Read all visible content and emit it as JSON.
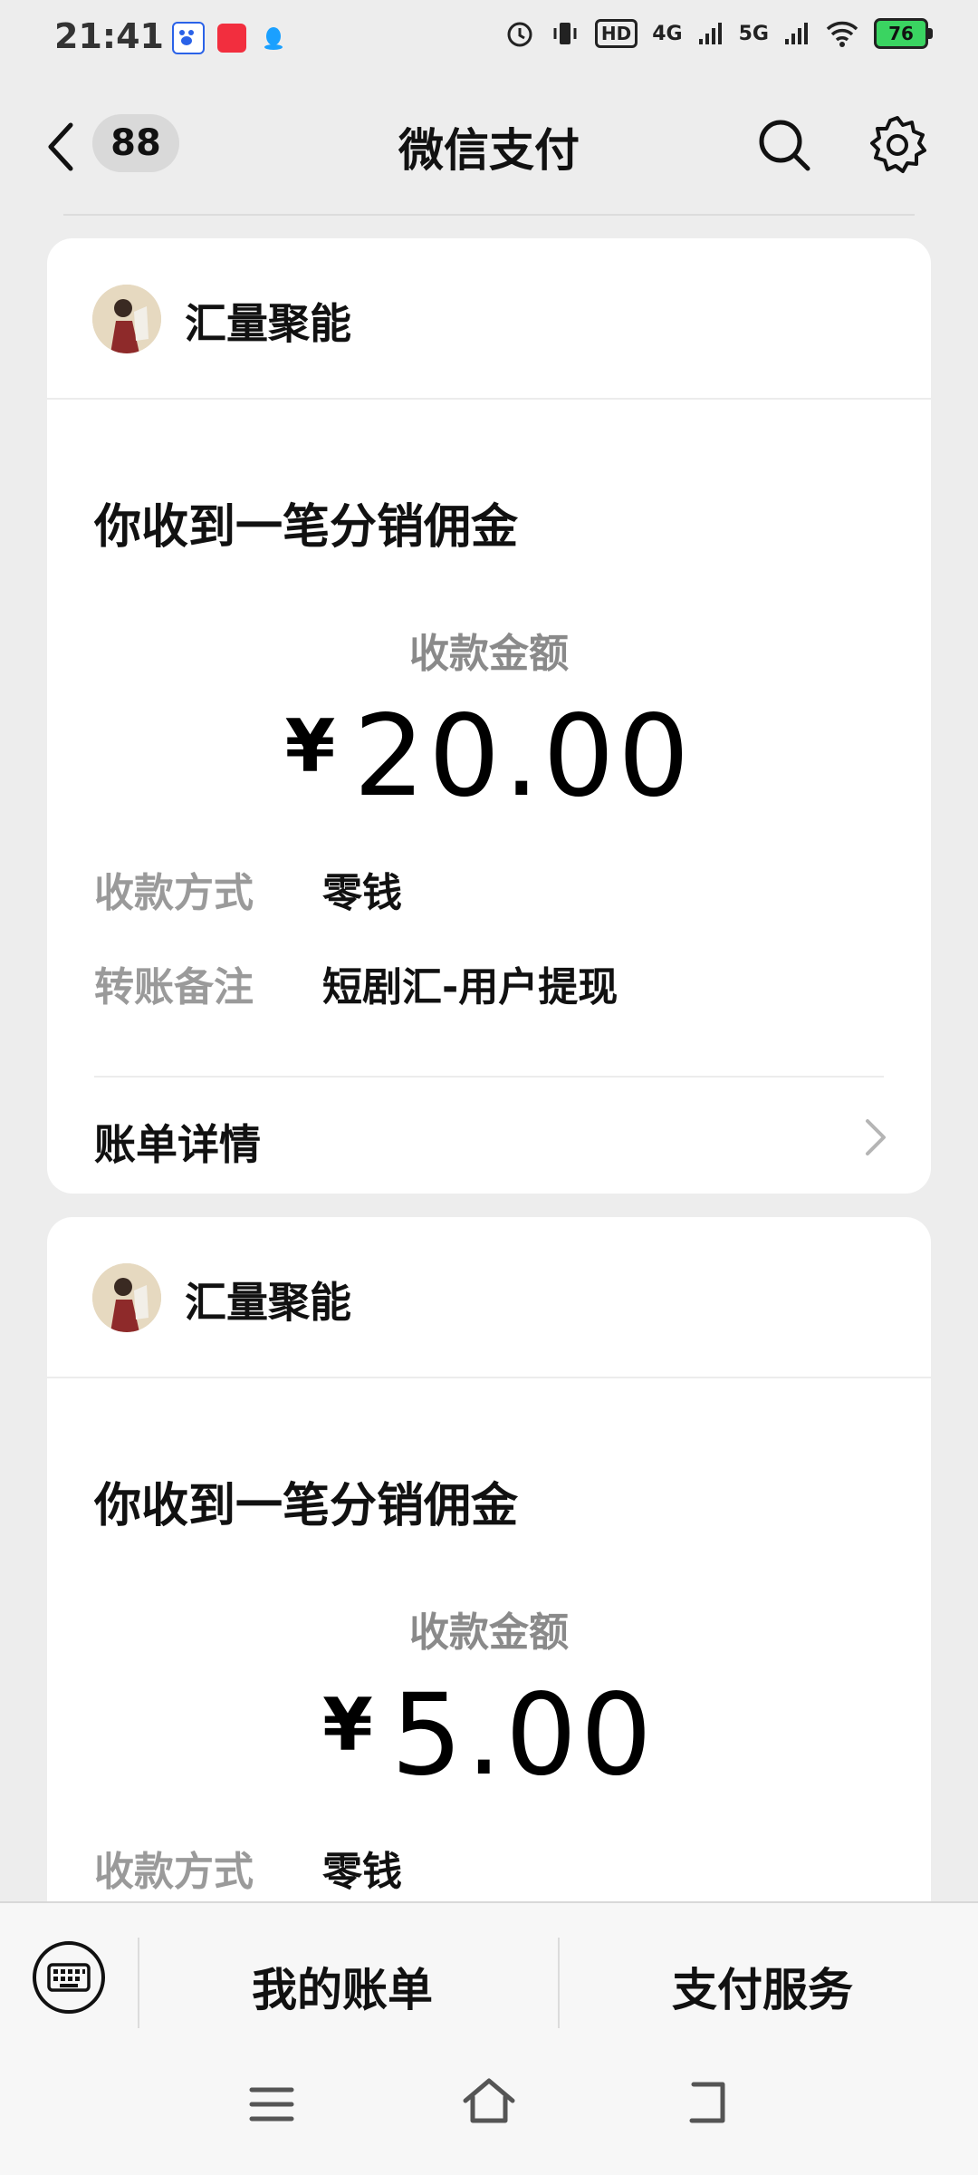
{
  "status_bar": {
    "time": "21:41",
    "hd": "HD",
    "net_4g": "4G",
    "net_5g": "5G",
    "battery": "76"
  },
  "header": {
    "badge_count": "88",
    "title": "微信支付"
  },
  "cards": [
    {
      "merchant": "汇量聚能",
      "title": "你收到一笔分销佣金",
      "amount_label": "收款金额",
      "currency": "¥",
      "amount": "20.00",
      "method_key": "收款方式",
      "method_value": "零钱",
      "remark_key": "转账备注",
      "remark_value": "短剧汇-用户提现",
      "bill_label": "账单详情"
    },
    {
      "merchant": "汇量聚能",
      "title": "你收到一笔分销佣金",
      "amount_label": "收款金额",
      "currency": "¥",
      "amount": "5.00",
      "method_key": "收款方式",
      "method_value": "零钱"
    }
  ],
  "tab_bar": {
    "my_bills": "我的账单",
    "pay_services": "支付服务"
  },
  "colors": {
    "background": "#ededed",
    "card": "#ffffff",
    "muted_text": "#9a9a9a",
    "battery_fill": "#3ad461"
  }
}
